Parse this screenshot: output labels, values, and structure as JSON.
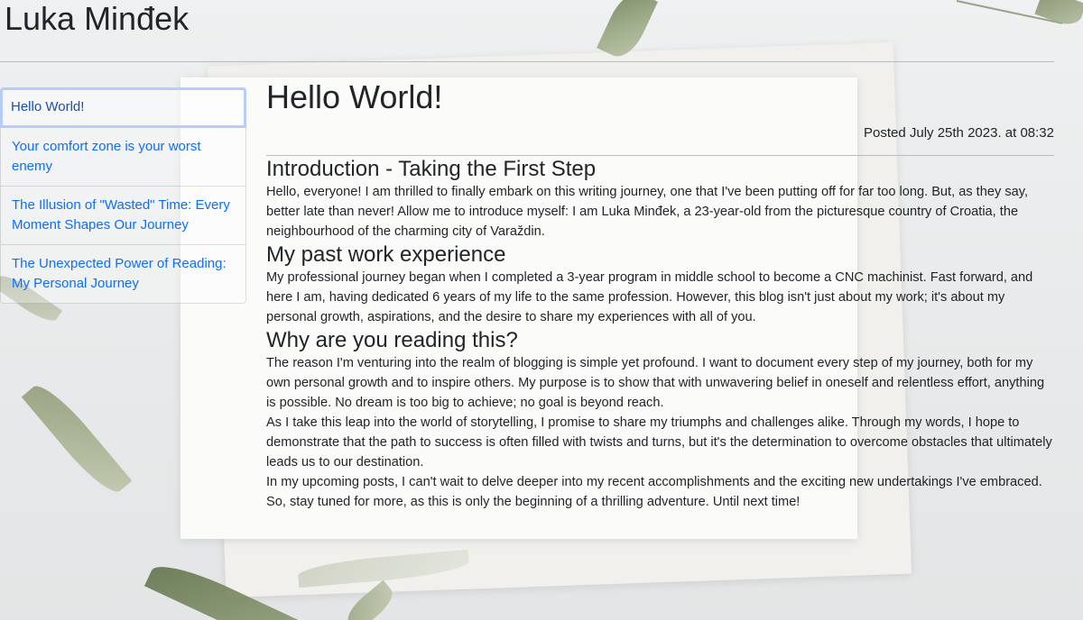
{
  "site": {
    "title": "Luka Minđek"
  },
  "sidebar": {
    "items": [
      {
        "label": "Hello World!"
      },
      {
        "label": "Your comfort zone is your worst enemy"
      },
      {
        "label": "The Illusion of \"Wasted\" Time: Every Moment Shapes Our Journey"
      },
      {
        "label": "The Unexpected Power of Reading: My Personal Journey"
      }
    ]
  },
  "post": {
    "title": "Hello World!",
    "posted": "Posted July 25th 2023. at 08:32",
    "sections": [
      {
        "heading": "Introduction - Taking the First Step",
        "paragraphs": [
          "Hello, everyone! I am thrilled to finally embark on this writing journey, one that I've been putting off for far too long. But, as they say, better late than never! Allow me to introduce myself: I am Luka Minđek, a 23-year-old from the picturesque country of Croatia, the neighbourhood of the charming city of Varaždin."
        ]
      },
      {
        "heading": "My past work experience",
        "paragraphs": [
          "My professional journey began when I completed a 3-year program in middle school to become a CNC machinist. Fast forward, and here I am, having dedicated 6 years of my life to the same profession. However, this blog isn't just about my work; it's about my personal growth, aspirations, and the desire to share my experiences with all of you."
        ]
      },
      {
        "heading": "Why are you reading this?",
        "paragraphs": [
          "The reason I'm venturing into the realm of blogging is simple yet profound. I want to document every step of my journey, both for my own personal growth and to inspire others. My purpose is to show that with unwavering belief in oneself and relentless effort, anything is possible. No dream is too big to achieve; no goal is beyond reach.",
          "As I take this leap into the world of storytelling, I promise to share my triumphs and challenges alike. Through my words, I hope to demonstrate that the path to success is often filled with twists and turns, but it's the determination to overcome obstacles that ultimately leads us to our destination.",
          "In my upcoming posts, I can't wait to delve deeper into my recent accomplishments and the exciting new undertakings I've embraced. So, stay tuned for more, as this is only the beginning of a thrilling adventure. Until next time!"
        ]
      }
    ]
  }
}
